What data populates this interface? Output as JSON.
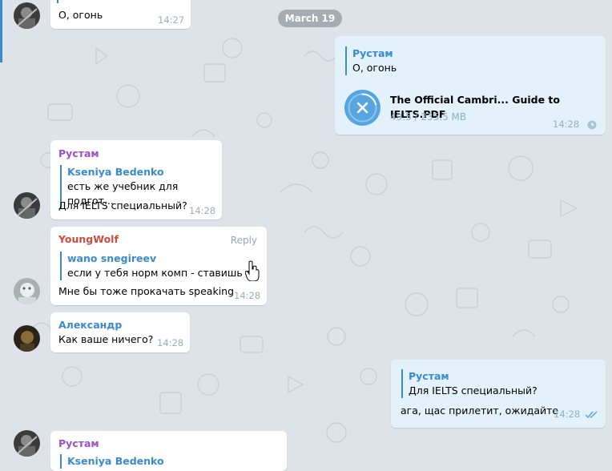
{
  "date_separator": "March 19",
  "colors": {
    "accent": "#3a8ad0",
    "rustam_name": "#9c4fc6",
    "youngwolf_name": "#cc4b3f",
    "alexandr_name": "#3a8ad0",
    "outgoing_bubble": "#e3f1fb",
    "chat_background": "#dde3e8"
  },
  "messages": [
    {
      "id": "m0",
      "direction": "in",
      "text": "О, огонь",
      "time": "14:27"
    },
    {
      "id": "m1",
      "direction": "out",
      "sender": "Рустам",
      "quote_text": "О, огонь",
      "file": {
        "name": "The Official Cambri... Guide to IELTS.PDF",
        "progress": "49.5 / 235.5 MB",
        "progress_fraction": 0.21,
        "icon": "cancel-download-icon"
      },
      "time": "14:28",
      "status_icon": "clock-icon"
    },
    {
      "id": "m2",
      "direction": "in",
      "sender": "Рустам",
      "quote_name": "Kseniya Bedenko",
      "quote_text": "есть же учебник для подгот...",
      "text": "Для IELTS специальный?",
      "time": "14:28"
    },
    {
      "id": "m3",
      "direction": "in",
      "sender": "YoungWolf",
      "reply_label": "Reply",
      "quote_name": "wano snegireev",
      "quote_text": "если у тебя норм комп - ставишь лк",
      "text": "Мне бы тоже прокачать speaking",
      "time": "14:28"
    },
    {
      "id": "m4",
      "direction": "in",
      "sender": "Александр",
      "text": "Как ваше ничего?",
      "time": "14:28"
    },
    {
      "id": "m5",
      "direction": "out",
      "quote_name": "Рустам",
      "quote_text": "Для IELTS специальный?",
      "text": "ага, щас прилетит, ожидайте",
      "time": "14:28",
      "status_icon": "double-check-icon"
    },
    {
      "id": "m6",
      "direction": "in",
      "sender": "Рустам",
      "quote_name": "Kseniya Bedenko"
    }
  ]
}
